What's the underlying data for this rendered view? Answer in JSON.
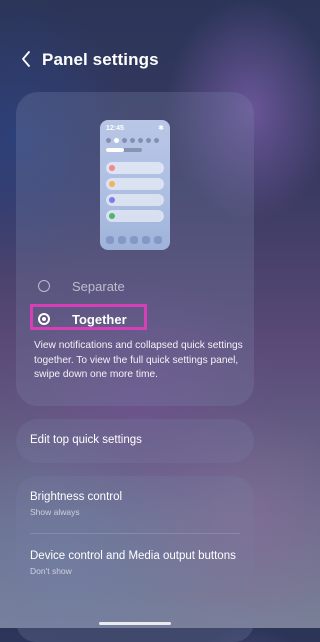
{
  "header": {
    "title": "Panel settings"
  },
  "preview": {
    "time": "12:45"
  },
  "layout_options": [
    {
      "label": "Separate",
      "selected": false
    },
    {
      "label": "Together",
      "selected": true
    }
  ],
  "description": "View notifications and collapsed quick settings together. To view the full quick settings panel, swipe down one more time.",
  "edit_item": {
    "label": "Edit top quick settings"
  },
  "brightness_item": {
    "label": "Brightness control",
    "value": "Show always"
  },
  "device_item": {
    "label": "Device control and Media output buttons",
    "value": "Don't show"
  },
  "colors": {
    "highlight": "#d63fb6"
  }
}
